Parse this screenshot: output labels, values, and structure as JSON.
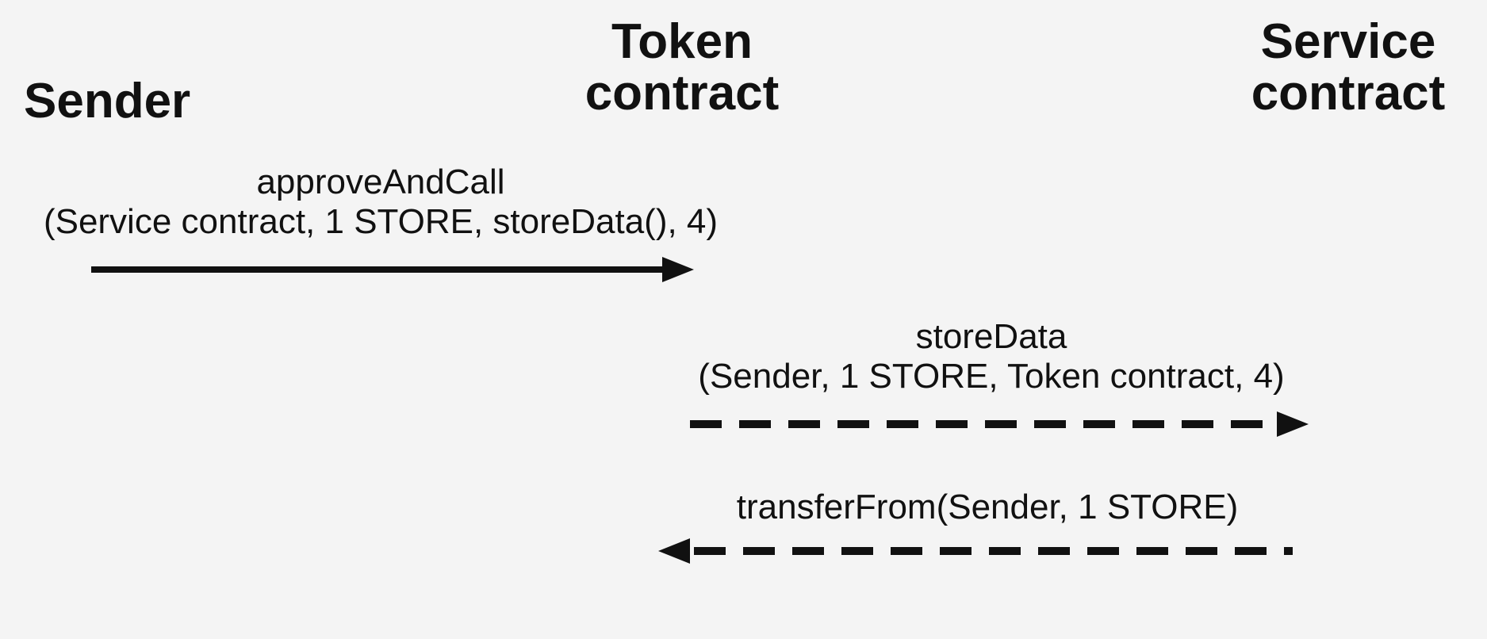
{
  "actors": {
    "sender": "Sender",
    "token_line1": "Token",
    "token_line2": "contract",
    "service_line1": "Service",
    "service_line2": "contract"
  },
  "messages": {
    "m1_line1": "approveAndCall",
    "m1_line2": "(Service contract, 1 STORE, storeData(), 4)",
    "m2_line1": "storeData",
    "m2_line2": "(Sender, 1 STORE, Token contract, 4)",
    "m3": "transferFrom(Sender, 1 STORE)"
  }
}
